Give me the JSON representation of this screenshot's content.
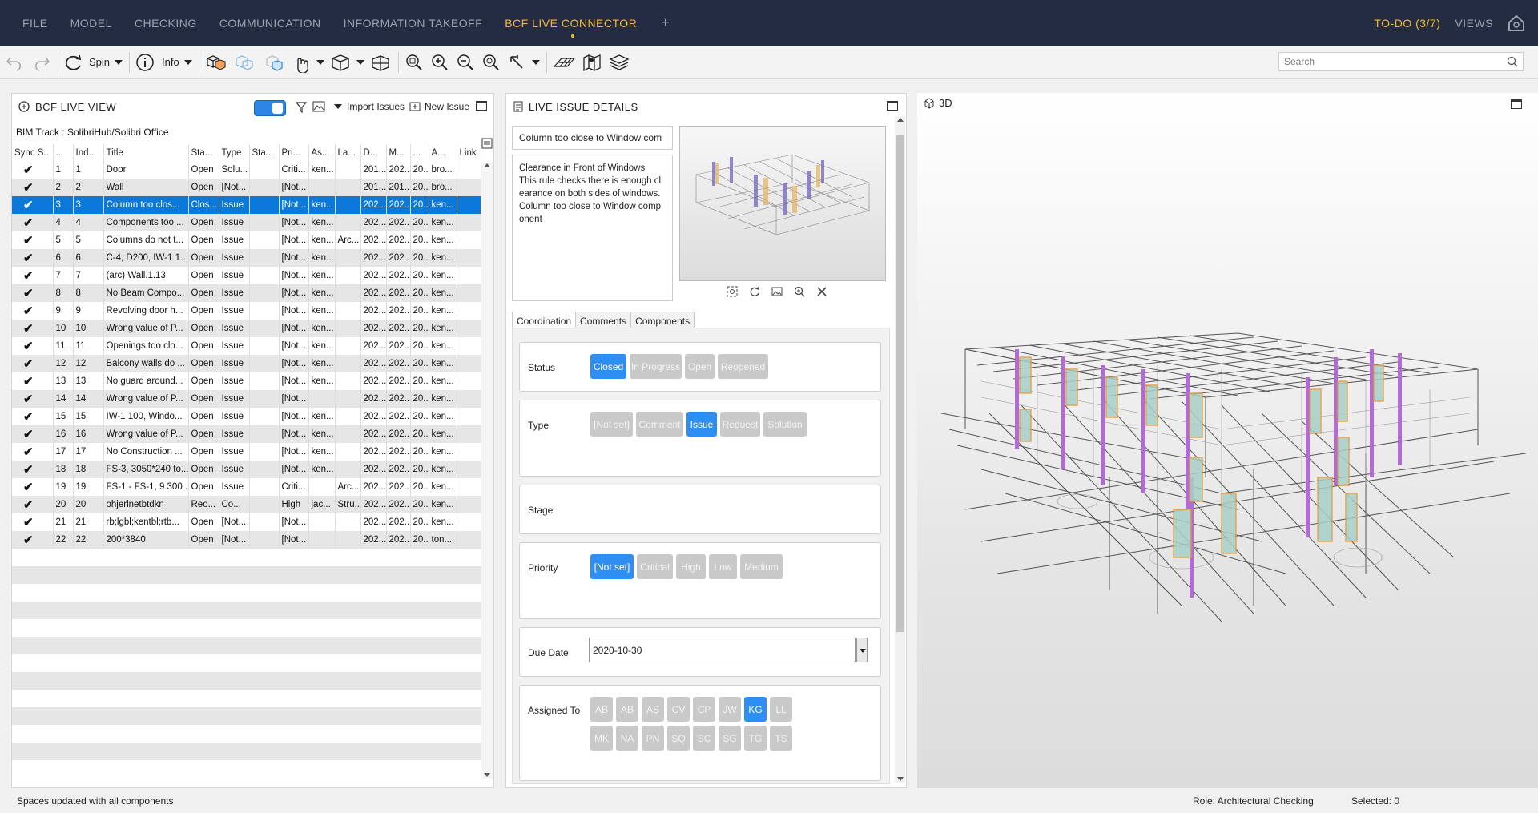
{
  "menu": {
    "items": [
      "FILE",
      "MODEL",
      "CHECKING",
      "COMMUNICATION",
      "INFORMATION TAKEOFF",
      "BCF LIVE CONNECTOR"
    ],
    "active": "BCF LIVE CONNECTOR",
    "plus": "+",
    "todo": "TO-DO (3/7)",
    "views": "VIEWS"
  },
  "toolbar": {
    "spin_label": "Spin",
    "info_label": "Info",
    "search_placeholder": "Search"
  },
  "bcf_panel": {
    "title": "BCF LIVE VIEW",
    "import_label": "Import Issues",
    "new_label": "New Issue",
    "project": "BIM Track : SolibriHub/Solibri Office",
    "columns": [
      "Sync S...",
      "...",
      "Ind...",
      "Title",
      "Sta...",
      "Type",
      "Sta...",
      "Pri...",
      "As...",
      "La...",
      "D...",
      "M...",
      "...",
      "A...",
      "Link"
    ],
    "rows": [
      [
        "1",
        "1",
        "Door",
        "Open",
        "Solu...",
        "",
        "Criti...",
        "ken...",
        "",
        "201...",
        "202...",
        "20...",
        "bro..."
      ],
      [
        "2",
        "2",
        "Wall",
        "Open",
        "[Not...",
        "",
        "[Not...",
        "",
        "",
        "201...",
        "201...",
        "20...",
        "bro..."
      ],
      [
        "3",
        "3",
        "Column too clos...",
        "Clos...",
        "Issue",
        "",
        "[Not...",
        "ken...",
        "",
        "202...",
        "202...",
        "20...",
        "ken..."
      ],
      [
        "4",
        "4",
        "Components too ...",
        "Open",
        "Issue",
        "",
        "[Not...",
        "ken...",
        "",
        "202...",
        "202...",
        "20...",
        "ken..."
      ],
      [
        "5",
        "5",
        "Columns do not t...",
        "Open",
        "Issue",
        "",
        "[Not...",
        "ken...",
        "Arc...",
        "202...",
        "202...",
        "20...",
        "ken..."
      ],
      [
        "6",
        "6",
        "C-4, D200, IW-1 1...",
        "Open",
        "Issue",
        "",
        "[Not...",
        "ken...",
        "",
        "202...",
        "202...",
        "20...",
        "ken..."
      ],
      [
        "7",
        "7",
        "(arc) Wall.1.13",
        "Open",
        "Issue",
        "",
        "[Not...",
        "ken...",
        "",
        "202...",
        "202...",
        "20...",
        "ken..."
      ],
      [
        "8",
        "8",
        "No Beam Compo...",
        "Open",
        "Issue",
        "",
        "[Not...",
        "ken...",
        "",
        "202...",
        "202...",
        "20...",
        "ken..."
      ],
      [
        "9",
        "9",
        "Revolving door h...",
        "Open",
        "Issue",
        "",
        "[Not...",
        "ken...",
        "",
        "202...",
        "202...",
        "20...",
        "ken..."
      ],
      [
        "10",
        "10",
        "Wrong value of P...",
        "Open",
        "Issue",
        "",
        "[Not...",
        "ken...",
        "",
        "202...",
        "202...",
        "20...",
        "ken..."
      ],
      [
        "11",
        "11",
        "Openings too clo...",
        "Open",
        "Issue",
        "",
        "[Not...",
        "ken...",
        "",
        "202...",
        "202...",
        "20...",
        "ken..."
      ],
      [
        "12",
        "12",
        "Balcony walls do ...",
        "Open",
        "Issue",
        "",
        "[Not...",
        "ken...",
        "",
        "202...",
        "202...",
        "20...",
        "ken..."
      ],
      [
        "13",
        "13",
        "No guard around...",
        "Open",
        "Issue",
        "",
        "[Not...",
        "ken...",
        "",
        "202...",
        "202...",
        "20...",
        "ken..."
      ],
      [
        "14",
        "14",
        "Wrong value of P...",
        "Open",
        "Issue",
        "",
        "[Not...",
        "",
        "",
        "202...",
        "202...",
        "20...",
        "ken..."
      ],
      [
        "15",
        "15",
        "IW-1 100, Windo...",
        "Open",
        "Issue",
        "",
        "[Not...",
        "ken...",
        "",
        "202...",
        "202...",
        "20...",
        "ken..."
      ],
      [
        "16",
        "16",
        "Wrong value of P...",
        "Open",
        "Issue",
        "",
        "[Not...",
        "ken...",
        "",
        "202...",
        "202...",
        "20...",
        "ken..."
      ],
      [
        "17",
        "17",
        "No Construction ...",
        "Open",
        "Issue",
        "",
        "[Not...",
        "ken...",
        "",
        "202...",
        "202...",
        "20...",
        "ken..."
      ],
      [
        "18",
        "18",
        "FS-3, 3050*240 to...",
        "Open",
        "Issue",
        "",
        "[Not...",
        "ken...",
        "",
        "202...",
        "202...",
        "20...",
        "ken..."
      ],
      [
        "19",
        "19",
        "FS-1 - FS-1, 9.300 ...",
        "Open",
        "Issue",
        "",
        "Criti...",
        "",
        "Arc...",
        "202...",
        "202...",
        "20...",
        "ken..."
      ],
      [
        "20",
        "20",
        "ohjerlnetbtdkn",
        "Reo...",
        "Co...",
        "",
        "High",
        "jac...",
        "Stru...",
        "202...",
        "202...",
        "20...",
        "ken..."
      ],
      [
        "21",
        "21",
        "rb;lgbl;kentbl;rtb...",
        "Open",
        "[Not...",
        "",
        "[Not...",
        "",
        "",
        "202...",
        "202...",
        "20...",
        "ken..."
      ],
      [
        "22",
        "22",
        "200*3840",
        "Open",
        "[Not...",
        "",
        "[Not...",
        "",
        "",
        "202...",
        "202...",
        "20...",
        "ton..."
      ]
    ],
    "selected_row": 3
  },
  "details_panel": {
    "title": "LIVE ISSUE DETAILS",
    "issue_title": "Column too close to Window com",
    "description": "Clearance in Front of Windows\nThis rule checks there is enough clearance on both sides of windows. Column too close to Window component",
    "tabs": [
      "Coordination",
      "Comments",
      "Components"
    ],
    "active_tab": "Coordination",
    "status_label": "Status",
    "status_options": [
      "Closed",
      "In Progress",
      "Open",
      "Reopened"
    ],
    "status_selected": "Closed",
    "type_label": "Type",
    "type_options": [
      "[Not set]",
      "Comment",
      "Issue",
      "Request",
      "Solution"
    ],
    "type_selected": "Issue",
    "stage_label": "Stage",
    "priority_label": "Priority",
    "priority_options": [
      "[Not set]",
      "Critical",
      "High",
      "Low",
      "Medium"
    ],
    "priority_selected": "[Not set]",
    "due_label": "Due Date",
    "due_value": "2020-10-30",
    "assigned_label": "Assigned To",
    "assignees": [
      "AB",
      "AB",
      "AS",
      "CV",
      "CP",
      "JW",
      "KG",
      "LL",
      "MK",
      "NA",
      "PN",
      "SQ",
      "SC",
      "SG",
      "TG",
      "TS"
    ],
    "assignee_selected": "KG"
  },
  "view3d": {
    "title": "3D"
  },
  "statusbar": {
    "message": "Spaces updated with all components",
    "role": "Role: Architectural Checking",
    "selected": "Selected: 0"
  }
}
